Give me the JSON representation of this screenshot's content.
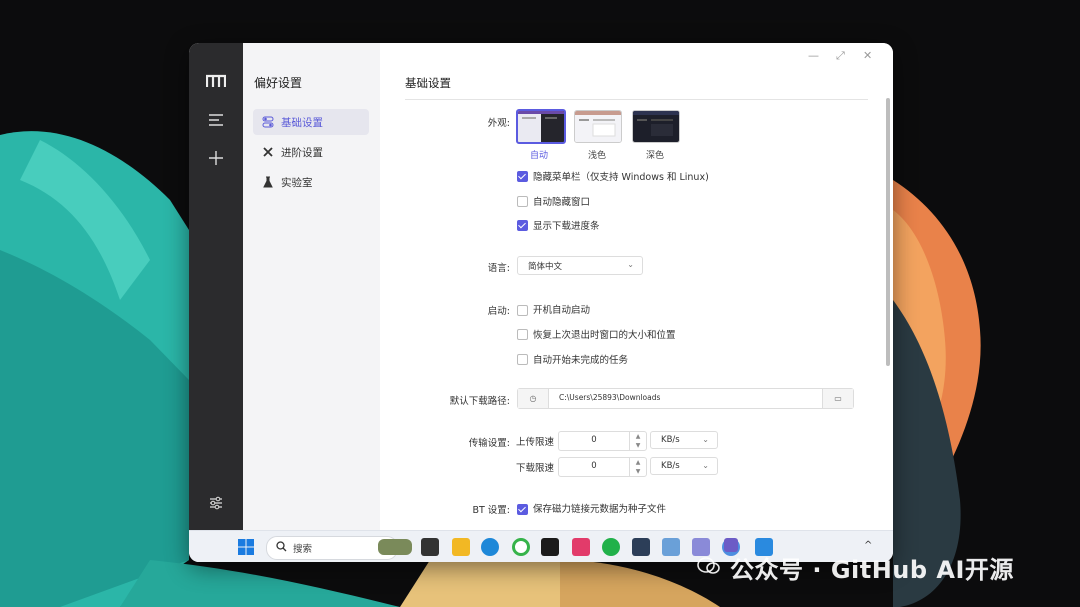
{
  "window_controls": {
    "minimize": "—",
    "maximize": "⤢",
    "close": "✕"
  },
  "sidebar": {
    "logo_icon": "m-logo-icon",
    "menu_icon": "hamburger-icon",
    "add_icon": "plus-icon",
    "settings_icon": "sliders-icon"
  },
  "prefs": {
    "title": "偏好设置",
    "items": [
      {
        "label": "基础设置",
        "icon": "toggle-icon",
        "active": true
      },
      {
        "label": "进阶设置",
        "icon": "tools-icon",
        "active": false
      },
      {
        "label": "实验室",
        "icon": "flask-icon",
        "active": false
      }
    ]
  },
  "content": {
    "section_title": "基础设置",
    "appearance": {
      "label": "外观:",
      "themes": [
        {
          "label": "自动",
          "selected": true
        },
        {
          "label": "浅色",
          "selected": false
        },
        {
          "label": "深色",
          "selected": false
        }
      ],
      "options": [
        {
          "label": "隐藏菜单栏（仅支持 Windows 和 Linux)",
          "checked": true
        },
        {
          "label": "自动隐藏窗口",
          "checked": false
        },
        {
          "label": "显示下载进度条",
          "checked": true
        }
      ]
    },
    "language": {
      "label": "语言:",
      "value": "简体中文"
    },
    "startup": {
      "label": "启动:",
      "options": [
        {
          "label": "开机自动启动",
          "checked": false
        },
        {
          "label": "恢复上次退出时窗口的大小和位置",
          "checked": false
        },
        {
          "label": "自动开始未完成的任务",
          "checked": false
        }
      ]
    },
    "download_path": {
      "label": "默认下载路径:",
      "value": "C:\\Users\\25893\\Downloads"
    },
    "transfer": {
      "label": "传输设置:",
      "upload": {
        "label": "上传限速",
        "value": "0",
        "unit": "KB/s"
      },
      "download": {
        "label": "下载限速",
        "value": "0",
        "unit": "KB/s"
      }
    },
    "bt": {
      "label": "BT 设置:",
      "option": {
        "label": "保存磁力链接元数据为种子文件",
        "checked": true
      }
    }
  },
  "taskbar": {
    "search_placeholder": "搜索",
    "time_glyph": "^"
  },
  "watermark": {
    "text": "公众号 · GitHub AI开源"
  }
}
